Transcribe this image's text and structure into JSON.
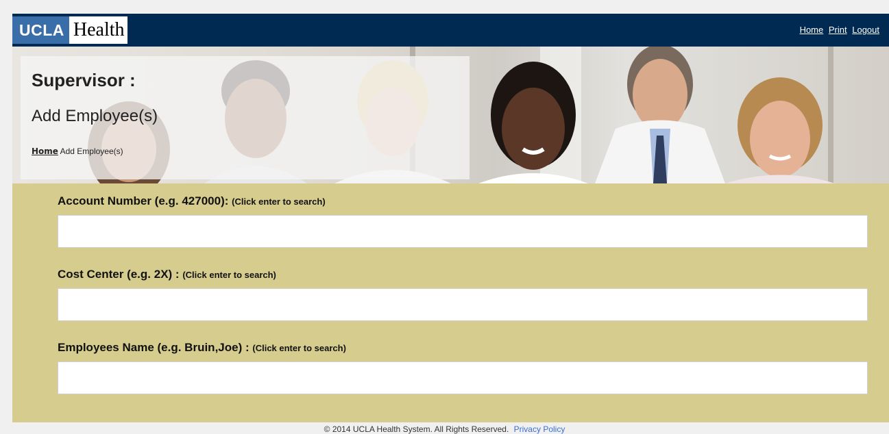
{
  "header": {
    "logo_ucla": "UCLA",
    "logo_health": "Health",
    "links": {
      "home": "Home",
      "print": "Print",
      "logout": "Logout"
    },
    "bar_color": "#002a52"
  },
  "banner": {
    "title": "Supervisor :",
    "subtitle": "Add Employee(s)",
    "breadcrumb": {
      "home_link": "Home",
      "current": "Add Employee(s)"
    }
  },
  "form": {
    "background_color": "#d5cc8e",
    "fields": [
      {
        "label": "Account Number (e.g. 427000):",
        "hint": "(Click enter to search)",
        "value": ""
      },
      {
        "label": "Cost Center (e.g. 2X) :",
        "hint": "(Click enter to search)",
        "value": ""
      },
      {
        "label": "Employees Name (e.g. Bruin,Joe) :",
        "hint": "(Click enter to search)",
        "value": ""
      }
    ]
  },
  "footer": {
    "copyright": "© 2014 UCLA Health System. All Rights Reserved.",
    "privacy_link": "Privacy Policy"
  }
}
